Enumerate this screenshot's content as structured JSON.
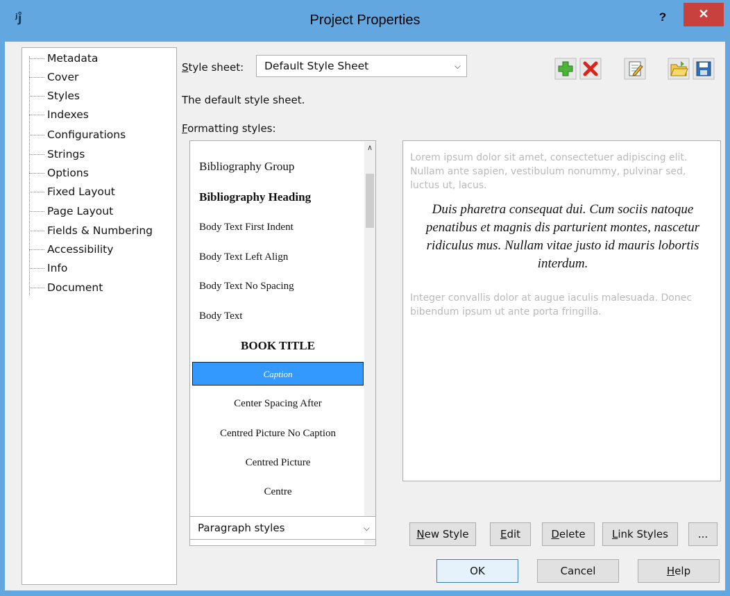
{
  "window": {
    "title": "Project Properties",
    "app_icon_text": "ʲj̊",
    "help_label": "?",
    "close_label": "✕"
  },
  "nav": {
    "items": [
      {
        "label": "Metadata"
      },
      {
        "label": "Cover"
      },
      {
        "label": "Styles"
      },
      {
        "label": "Indexes"
      },
      {
        "label": "Configurations"
      },
      {
        "label": "Strings"
      },
      {
        "label": "Options"
      },
      {
        "label": "Fixed Layout"
      },
      {
        "label": "Page Layout"
      },
      {
        "label": "Fields & Numbering"
      },
      {
        "label": "Accessibility"
      },
      {
        "label": "Info"
      },
      {
        "label": "Document"
      }
    ]
  },
  "stylesheet": {
    "label_prefix": "S",
    "label_rest": "tyle sheet:",
    "selected": "Default Style Sheet",
    "description": "The default style sheet."
  },
  "toolbar": {
    "add_icon": "plus-icon",
    "delete_icon": "delete-icon",
    "edit_icon": "edit-icon",
    "open_icon": "open-folder-icon",
    "save_icon": "save-icon"
  },
  "formatting": {
    "label_prefix": "F",
    "label_rest": "ormatting styles:",
    "styles": [
      {
        "name": "Bibliography Group"
      },
      {
        "name": "Bibliography Heading"
      },
      {
        "name": "Body Text First Indent"
      },
      {
        "name": "Body Text Left Align"
      },
      {
        "name": "Body Text No Spacing"
      },
      {
        "name": "Body Text"
      },
      {
        "name": "BOOK TITLE"
      },
      {
        "name": "Caption"
      },
      {
        "name": "Center Spacing After"
      },
      {
        "name": "Centred Picture No Caption"
      },
      {
        "name": "Centred Picture"
      },
      {
        "name": "Centre"
      }
    ],
    "selected_index": 7,
    "type_selector": "Paragraph styles"
  },
  "preview": {
    "before": "Lorem ipsum dolor sit amet, consectetuer adipiscing elit. Nullam ante sapien, vestibulum nonummy, pulvinar sed, luctus ut, lacus.",
    "sample": "Duis pharetra consequat dui. Cum sociis natoque penatibus et magnis dis parturient montes, nascetur ridiculus mus. Nullam vitae justo id mauris lobortis interdum.",
    "after": "Integer convallis dolor at augue iaculis malesuada. Donec bibendum ipsum ut ante porta fringilla."
  },
  "style_buttons": {
    "new_style_u": "N",
    "new_style_rest": "ew Style",
    "edit_u": "E",
    "edit_rest": "dit",
    "delete_u": "D",
    "delete_rest": "elete",
    "link_styles_u": "L",
    "link_styles_rest": "ink Styles",
    "more": "..."
  },
  "dialog_buttons": {
    "ok": "OK",
    "cancel": "Cancel",
    "help_u": "H",
    "help_rest": "elp"
  },
  "colors": {
    "titlebar": "#62a7e0",
    "close": "#c8413c",
    "selection": "#3399ff"
  }
}
